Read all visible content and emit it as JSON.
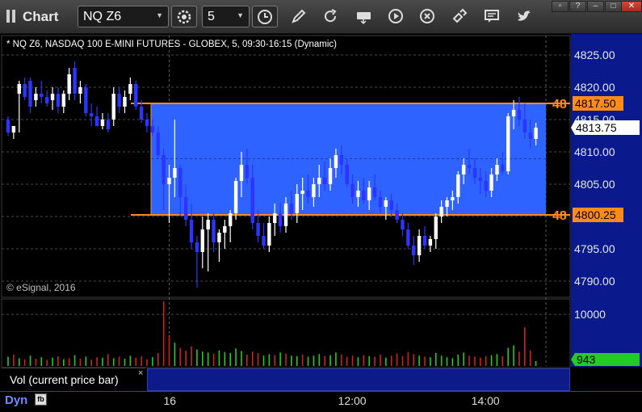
{
  "toolbar": {
    "title": "Chart",
    "symbol": "NQ Z6",
    "interval": "5",
    "colors": {
      "bg": "#333333",
      "close": "#c0392b"
    }
  },
  "chart": {
    "header": "* NQ Z6, NASDAQ 100 E-MINI FUTURES - GLOBEX, 5, 09:30-16:15 (Dynamic)",
    "copyright": "© eSignal, 2016",
    "volume_panel_label": "Vol (current price bar)",
    "volume_close_glyph": "×",
    "dyn_label": "Dyn",
    "dyn_icon_text": "fb"
  },
  "chart_data": {
    "type": "candlestick",
    "price_axis": {
      "ticks": [
        "4825.00",
        "4820.00",
        "4815.00",
        "4810.00",
        "4805.00",
        "4800.00",
        "4795.00",
        "4790.00"
      ],
      "ylim": [
        4787.5,
        4828.0
      ]
    },
    "volume_axis": {
      "ticks": [
        "10000"
      ],
      "current_value": "943",
      "ylim": [
        0,
        13000
      ]
    },
    "x_ticks": [
      {
        "label": "16",
        "bar": 29
      },
      {
        "label": "12:00",
        "bar": 62
      },
      {
        "label": "14:00",
        "bar": 86
      }
    ],
    "current_price": "4813.75",
    "range_box": {
      "upper_price": 4817.5,
      "upper_label": "4817.50",
      "upper_tag": "48",
      "lower_price": 4800.25,
      "lower_label": "4800.25",
      "lower_tag": "48",
      "fill_color": "#2e63ff",
      "line_color": "#ff8c1a"
    },
    "colors": {
      "up": "#ffffff",
      "down": "#2b35ff",
      "vol_up": "#22cc22",
      "vol_down": "#cc2222",
      "current_price_bg": "#ffffff",
      "volume_tag_bg": "#22cc22"
    },
    "candles": [
      [
        4815.0,
        4815.5,
        4812.5,
        4813.0
      ],
      [
        4813.0,
        4814.0,
        4812.0,
        4814.0
      ],
      [
        4819.0,
        4821.0,
        4813.0,
        4820.5
      ],
      [
        4820.5,
        4821.5,
        4818.0,
        4818.5
      ],
      [
        4821.0,
        4821.5,
        4816.0,
        4817.0
      ],
      [
        4818.0,
        4820.0,
        4817.0,
        4819.0
      ],
      [
        4819.0,
        4821.0,
        4817.5,
        4818.5
      ],
      [
        4818.5,
        4819.5,
        4817.0,
        4817.5
      ],
      [
        4818.0,
        4820.0,
        4816.5,
        4819.0
      ],
      [
        4819.0,
        4820.0,
        4816.0,
        4817.0
      ],
      [
        4817.0,
        4819.5,
        4816.0,
        4819.0
      ],
      [
        4819.0,
        4823.0,
        4818.0,
        4822.0
      ],
      [
        4823.0,
        4824.0,
        4818.0,
        4819.0
      ],
      [
        4819.0,
        4821.0,
        4817.5,
        4820.0
      ],
      [
        4820.0,
        4820.5,
        4815.5,
        4816.0
      ],
      [
        4816.0,
        4817.5,
        4814.0,
        4815.5
      ],
      [
        4815.5,
        4817.0,
        4814.0,
        4814.0
      ],
      [
        4814.0,
        4816.0,
        4813.5,
        4815.0
      ],
      [
        4815.0,
        4816.0,
        4813.0,
        4813.5
      ],
      [
        4815.0,
        4820.0,
        4814.0,
        4819.0
      ],
      [
        4819.0,
        4820.0,
        4816.0,
        4817.0
      ],
      [
        4817.0,
        4819.5,
        4816.0,
        4818.5
      ],
      [
        4819.0,
        4821.5,
        4818.0,
        4820.5
      ],
      [
        4820.5,
        4821.0,
        4816.5,
        4817.0
      ],
      [
        4817.0,
        4818.0,
        4814.5,
        4815.0
      ],
      [
        4815.0,
        4816.0,
        4813.0,
        4814.0
      ],
      [
        4814.0,
        4815.0,
        4812.5,
        4813.0
      ],
      [
        4813.0,
        4814.0,
        4809.0,
        4809.5
      ],
      [
        4809.5,
        4810.5,
        4801.0,
        4805.0
      ],
      [
        4805.0,
        4808.0,
        4799.0,
        4806.0
      ],
      [
        4806.0,
        4815.0,
        4803.0,
        4807.5
      ],
      [
        4807.5,
        4808.0,
        4800.0,
        4803.0
      ],
      [
        4803.0,
        4805.0,
        4798.5,
        4799.5
      ],
      [
        4799.5,
        4802.0,
        4795.0,
        4796.0
      ],
      [
        4796.0,
        4797.0,
        4789.0,
        4794.5
      ],
      [
        4794.5,
        4800.0,
        4792.0,
        4798.0
      ],
      [
        4798.0,
        4800.5,
        4791.5,
        4799.5
      ],
      [
        4799.5,
        4800.5,
        4794.5,
        4796.0
      ],
      [
        4796.0,
        4798.0,
        4793.0,
        4797.5
      ],
      [
        4797.5,
        4799.5,
        4795.0,
        4798.5
      ],
      [
        4798.5,
        4801.0,
        4796.0,
        4800.5
      ],
      [
        4800.5,
        4806.0,
        4799.5,
        4805.5
      ],
      [
        4805.5,
        4810.0,
        4803.0,
        4808.0
      ],
      [
        4808.0,
        4810.5,
        4805.0,
        4806.0
      ],
      [
        4806.0,
        4808.0,
        4798.0,
        4799.0
      ],
      [
        4799.0,
        4801.0,
        4796.0,
        4797.0
      ],
      [
        4797.0,
        4799.0,
        4795.0,
        4795.5
      ],
      [
        4795.5,
        4800.0,
        4794.5,
        4799.0
      ],
      [
        4799.0,
        4802.0,
        4797.0,
        4800.5
      ],
      [
        4800.5,
        4802.0,
        4797.5,
        4798.5
      ],
      [
        4798.5,
        4803.0,
        4797.5,
        4802.0
      ],
      [
        4802.0,
        4804.0,
        4799.5,
        4800.5
      ],
      [
        4800.5,
        4805.0,
        4799.0,
        4803.5
      ],
      [
        4803.5,
        4806.0,
        4801.0,
        4804.0
      ],
      [
        4804.0,
        4806.5,
        4802.0,
        4803.0
      ],
      [
        4803.0,
        4806.0,
        4801.5,
        4805.0
      ],
      [
        4805.0,
        4808.0,
        4803.0,
        4806.0
      ],
      [
        4806.0,
        4808.5,
        4804.0,
        4805.0
      ],
      [
        4805.0,
        4809.0,
        4804.0,
        4807.5
      ],
      [
        4807.5,
        4810.5,
        4806.0,
        4809.5
      ],
      [
        4809.5,
        4811.0,
        4806.5,
        4808.0
      ],
      [
        4808.0,
        4809.0,
        4804.5,
        4805.0
      ],
      [
        4805.0,
        4806.5,
        4802.0,
        4803.0
      ],
      [
        4803.0,
        4805.5,
        4801.5,
        4804.0
      ],
      [
        4804.0,
        4806.0,
        4802.0,
        4802.5
      ],
      [
        4802.5,
        4805.5,
        4801.0,
        4804.5
      ],
      [
        4804.5,
        4806.5,
        4802.5,
        4803.0
      ],
      [
        4803.0,
        4804.0,
        4800.5,
        4801.5
      ],
      [
        4801.5,
        4803.0,
        4799.5,
        4802.5
      ],
      [
        4802.5,
        4803.5,
        4800.0,
        4801.0
      ],
      [
        4801.0,
        4802.0,
        4799.0,
        4799.5
      ],
      [
        4799.5,
        4800.5,
        4797.0,
        4798.0
      ],
      [
        4798.0,
        4799.0,
        4795.0,
        4795.5
      ],
      [
        4795.5,
        4797.0,
        4792.5,
        4794.0
      ],
      [
        4794.0,
        4798.0,
        4793.0,
        4797.0
      ],
      [
        4797.0,
        4798.5,
        4795.0,
        4795.5
      ],
      [
        4795.5,
        4797.0,
        4794.5,
        4796.5
      ],
      [
        4796.5,
        4800.5,
        4795.0,
        4800.0
      ],
      [
        4800.0,
        4802.5,
        4799.0,
        4801.5
      ],
      [
        4801.5,
        4803.0,
        4800.0,
        4802.5
      ],
      [
        4802.5,
        4804.0,
        4801.0,
        4803.0
      ],
      [
        4803.0,
        4807.0,
        4802.0,
        4806.5
      ],
      [
        4806.5,
        4809.0,
        4805.0,
        4808.0
      ],
      [
        4808.0,
        4810.5,
        4806.5,
        4807.5
      ],
      [
        4807.5,
        4809.0,
        4805.0,
        4806.0
      ],
      [
        4806.0,
        4807.5,
        4803.5,
        4805.5
      ],
      [
        4805.5,
        4807.0,
        4803.0,
        4804.0
      ],
      [
        4804.0,
        4807.5,
        4803.0,
        4806.5
      ],
      [
        4806.5,
        4809.0,
        4805.5,
        4808.0
      ],
      [
        4808.0,
        4810.0,
        4806.5,
        4807.0
      ],
      [
        4807.0,
        4816.0,
        4806.5,
        4815.5
      ],
      [
        4815.5,
        4818.0,
        4813.5,
        4816.5
      ],
      [
        4816.5,
        4818.5,
        4814.0,
        4815.0
      ],
      [
        4815.0,
        4817.5,
        4812.0,
        4813.0
      ],
      [
        4813.0,
        4815.0,
        4810.5,
        4812.0
      ],
      [
        4812.0,
        4814.5,
        4811.0,
        4813.75
      ]
    ],
    "volume": [
      [
        1800,
        1
      ],
      [
        2200,
        0
      ],
      [
        1500,
        1
      ],
      [
        1300,
        0
      ],
      [
        2000,
        1
      ],
      [
        1400,
        0
      ],
      [
        1700,
        1
      ],
      [
        1200,
        0
      ],
      [
        1600,
        1
      ],
      [
        1900,
        0
      ],
      [
        1300,
        1
      ],
      [
        1500,
        0
      ],
      [
        2100,
        1
      ],
      [
        1400,
        0
      ],
      [
        1800,
        1
      ],
      [
        1200,
        0
      ],
      [
        1700,
        0
      ],
      [
        1600,
        1
      ],
      [
        2300,
        0
      ],
      [
        1500,
        1
      ],
      [
        1800,
        0
      ],
      [
        1400,
        1
      ],
      [
        2000,
        1
      ],
      [
        1600,
        0
      ],
      [
        1900,
        0
      ],
      [
        1300,
        0
      ],
      [
        1700,
        1
      ],
      [
        2500,
        0
      ],
      [
        12500,
        0
      ],
      [
        6000,
        0
      ],
      [
        4500,
        1
      ],
      [
        3500,
        0
      ],
      [
        3000,
        0
      ],
      [
        3800,
        0
      ],
      [
        3200,
        1
      ],
      [
        2800,
        1
      ],
      [
        2600,
        1
      ],
      [
        2400,
        0
      ],
      [
        3000,
        1
      ],
      [
        2700,
        1
      ],
      [
        2500,
        1
      ],
      [
        3400,
        1
      ],
      [
        2900,
        1
      ],
      [
        2200,
        0
      ],
      [
        2800,
        0
      ],
      [
        2500,
        0
      ],
      [
        2000,
        1
      ],
      [
        2300,
        1
      ],
      [
        2100,
        0
      ],
      [
        2600,
        1
      ],
      [
        2400,
        0
      ],
      [
        2000,
        1
      ],
      [
        1900,
        1
      ],
      [
        2200,
        0
      ],
      [
        1800,
        1
      ],
      [
        2000,
        1
      ],
      [
        2300,
        1
      ],
      [
        1900,
        0
      ],
      [
        2100,
        1
      ],
      [
        2600,
        1
      ],
      [
        2200,
        0
      ],
      [
        1800,
        0
      ],
      [
        2000,
        0
      ],
      [
        1700,
        1
      ],
      [
        2100,
        0
      ],
      [
        1900,
        1
      ],
      [
        1800,
        0
      ],
      [
        2200,
        0
      ],
      [
        1600,
        1
      ],
      [
        2000,
        0
      ],
      [
        2400,
        0
      ],
      [
        1900,
        0
      ],
      [
        2700,
        0
      ],
      [
        2300,
        0
      ],
      [
        2000,
        1
      ],
      [
        1800,
        0
      ],
      [
        1700,
        1
      ],
      [
        2500,
        1
      ],
      [
        2000,
        1
      ],
      [
        1700,
        1
      ],
      [
        1500,
        1
      ],
      [
        2200,
        1
      ],
      [
        2600,
        1
      ],
      [
        2000,
        0
      ],
      [
        1800,
        0
      ],
      [
        1600,
        0
      ],
      [
        1900,
        0
      ],
      [
        2100,
        1
      ],
      [
        2300,
        1
      ],
      [
        1900,
        0
      ],
      [
        3500,
        1
      ],
      [
        4000,
        1
      ],
      [
        2800,
        0
      ],
      [
        7500,
        0
      ],
      [
        3000,
        0
      ],
      [
        943,
        1
      ]
    ]
  }
}
